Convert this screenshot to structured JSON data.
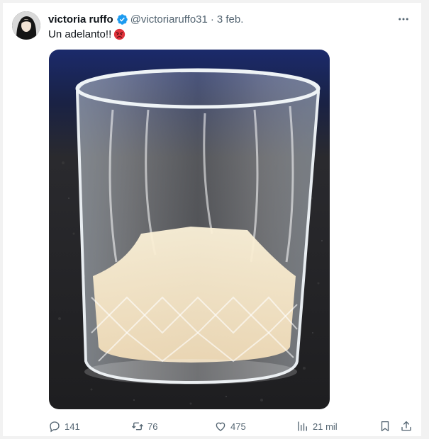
{
  "post": {
    "author_name": "victoria ruffo",
    "handle": "@victoriaruffo31",
    "separator": "·",
    "date": "3 feb.",
    "text": "Un adelanto!!",
    "emoji": "angry-face-icon"
  },
  "metrics": {
    "replies": "141",
    "reposts": "76",
    "likes": "475",
    "views": "21 mil"
  },
  "colors": {
    "text_primary": "#0f1419",
    "text_secondary": "#536471",
    "verified": "#1d9bf0"
  }
}
